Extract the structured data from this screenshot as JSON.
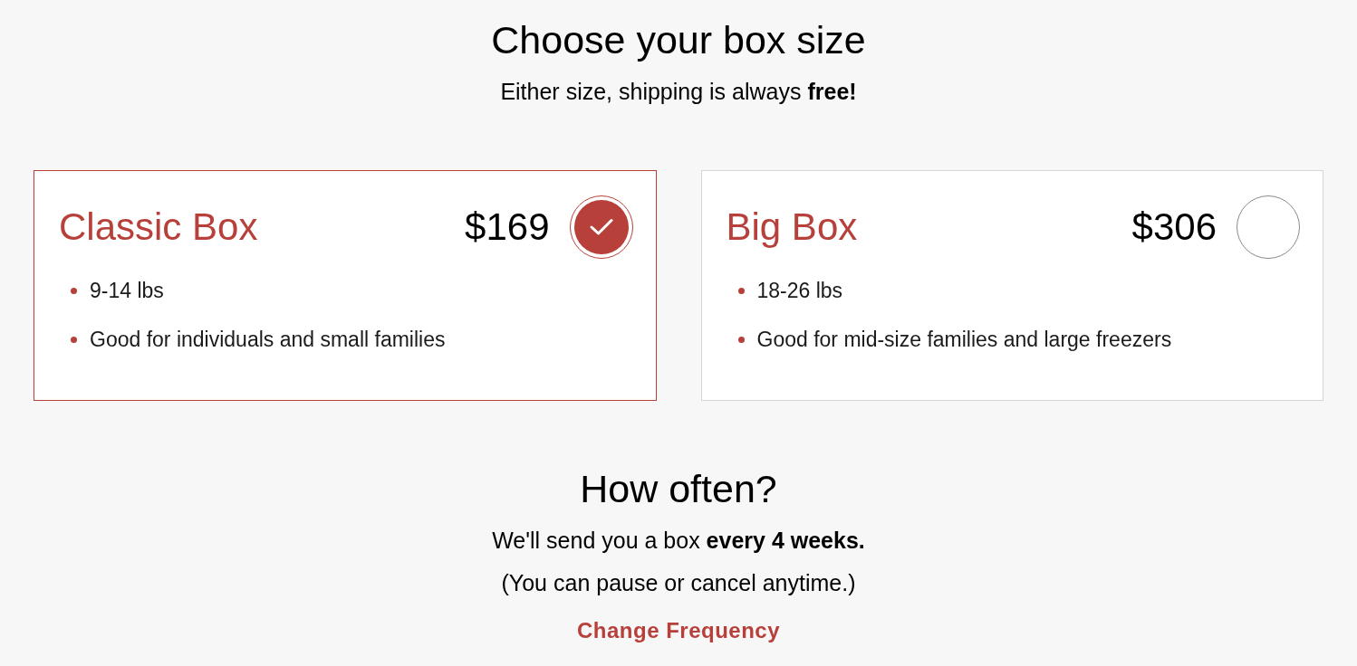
{
  "header": {
    "title": "Choose your box size",
    "subtitle": "Either size, shipping is always **free!**"
  },
  "boxes": [
    {
      "name": "Classic Box",
      "price": "$169",
      "selected": true,
      "features": [
        "9-14 lbs",
        "Good for individuals and small families"
      ]
    },
    {
      "name": "Big Box",
      "price": "$306",
      "selected": false,
      "features": [
        "18-26 lbs",
        "Good for mid-size families and large freezers"
      ]
    }
  ],
  "frequency": {
    "title": "How often?",
    "lines": [
      "We'll send you a box **every 4 weeks.**",
      "(You can pause or cancel anytime.)"
    ],
    "link": "Change Frequency"
  }
}
